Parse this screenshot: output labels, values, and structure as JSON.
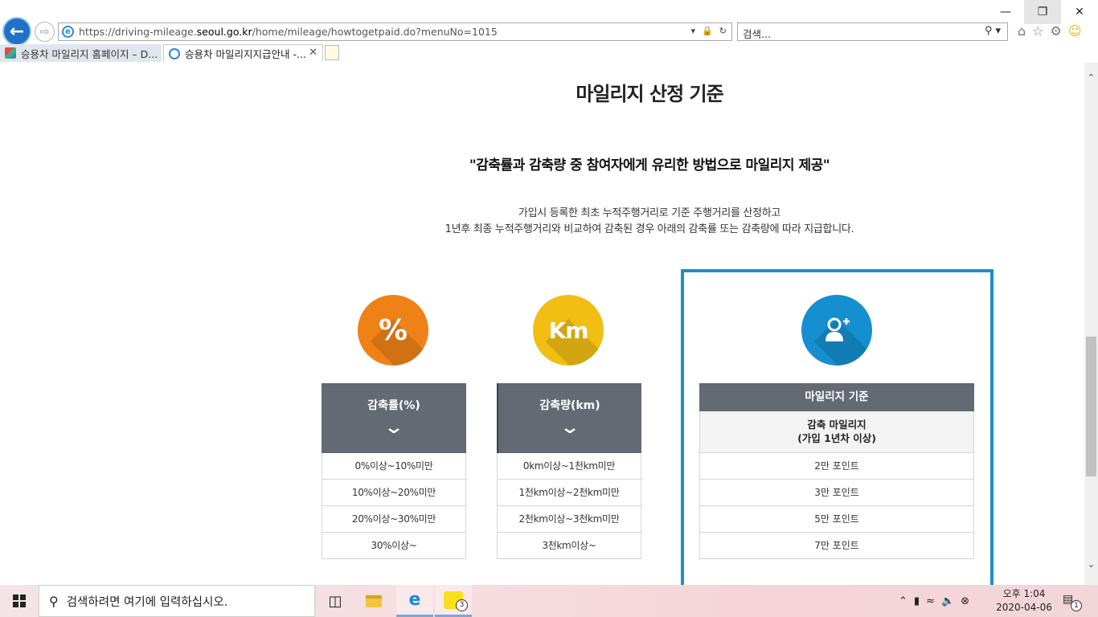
{
  "browser": {
    "url_prefix": "https://driving-mileage.",
    "url_host": "seoul.go.kr",
    "url_rest": "/home/mileage/howtogetpaid.do?menuNo=1015",
    "search_placeholder": "검색...",
    "tabs": [
      {
        "label": "승용차 마일리지 홈페이지 – D..."
      },
      {
        "label": "승용차 마일리지지급안내 -..."
      }
    ]
  },
  "page": {
    "title": "마일리지 산정 기준",
    "subtitle": "\"감축률과 감축량 중 참여자에게 유리한 방법으로 마일리지 제공\"",
    "desc_line1": "가입시 등록한 최초 누적주행거리로 기준 주행거리를 산정하고",
    "desc_line2": "1년후 최종 누적주행거리와 비교하여 감축된 경우 아래의 감축률 또는 감축량에 따라 지급합니다.",
    "icons": {
      "rate": "%",
      "amount": "Km",
      "mileage": "user-plus-icon"
    },
    "rate_column": {
      "header": "감축률(%)",
      "rows": [
        "0%이상~10%미만",
        "10%이상~20%미만",
        "20%이상~30%미만",
        "30%이상~"
      ]
    },
    "amount_column": {
      "header": "감축량(km)",
      "rows": [
        "0km이상~1천km미만",
        "1천km이상~2천km미만",
        "2천km이상~3천km미만",
        "3천km이상~"
      ]
    },
    "mileage_table": {
      "header": "마일리지 기준",
      "subheader": "감축 마일리지\n(가입 1년차 이상)",
      "rows": [
        "2만 포인트",
        "3만 포인트",
        "5만 포인트",
        "7만 포인트"
      ]
    }
  },
  "taskbar": {
    "search_placeholder": "검색하려면 여기에 입력하십시오.",
    "kakao_badge": "3",
    "time": "오후 1:04",
    "date": "2020-04-06",
    "notification_count": "1"
  },
  "colors": {
    "orange": "#ef8217",
    "yellow": "#f2be14",
    "blue": "#158fd0",
    "header_gray": "#646a74",
    "highlight_border": "#1990c8"
  }
}
